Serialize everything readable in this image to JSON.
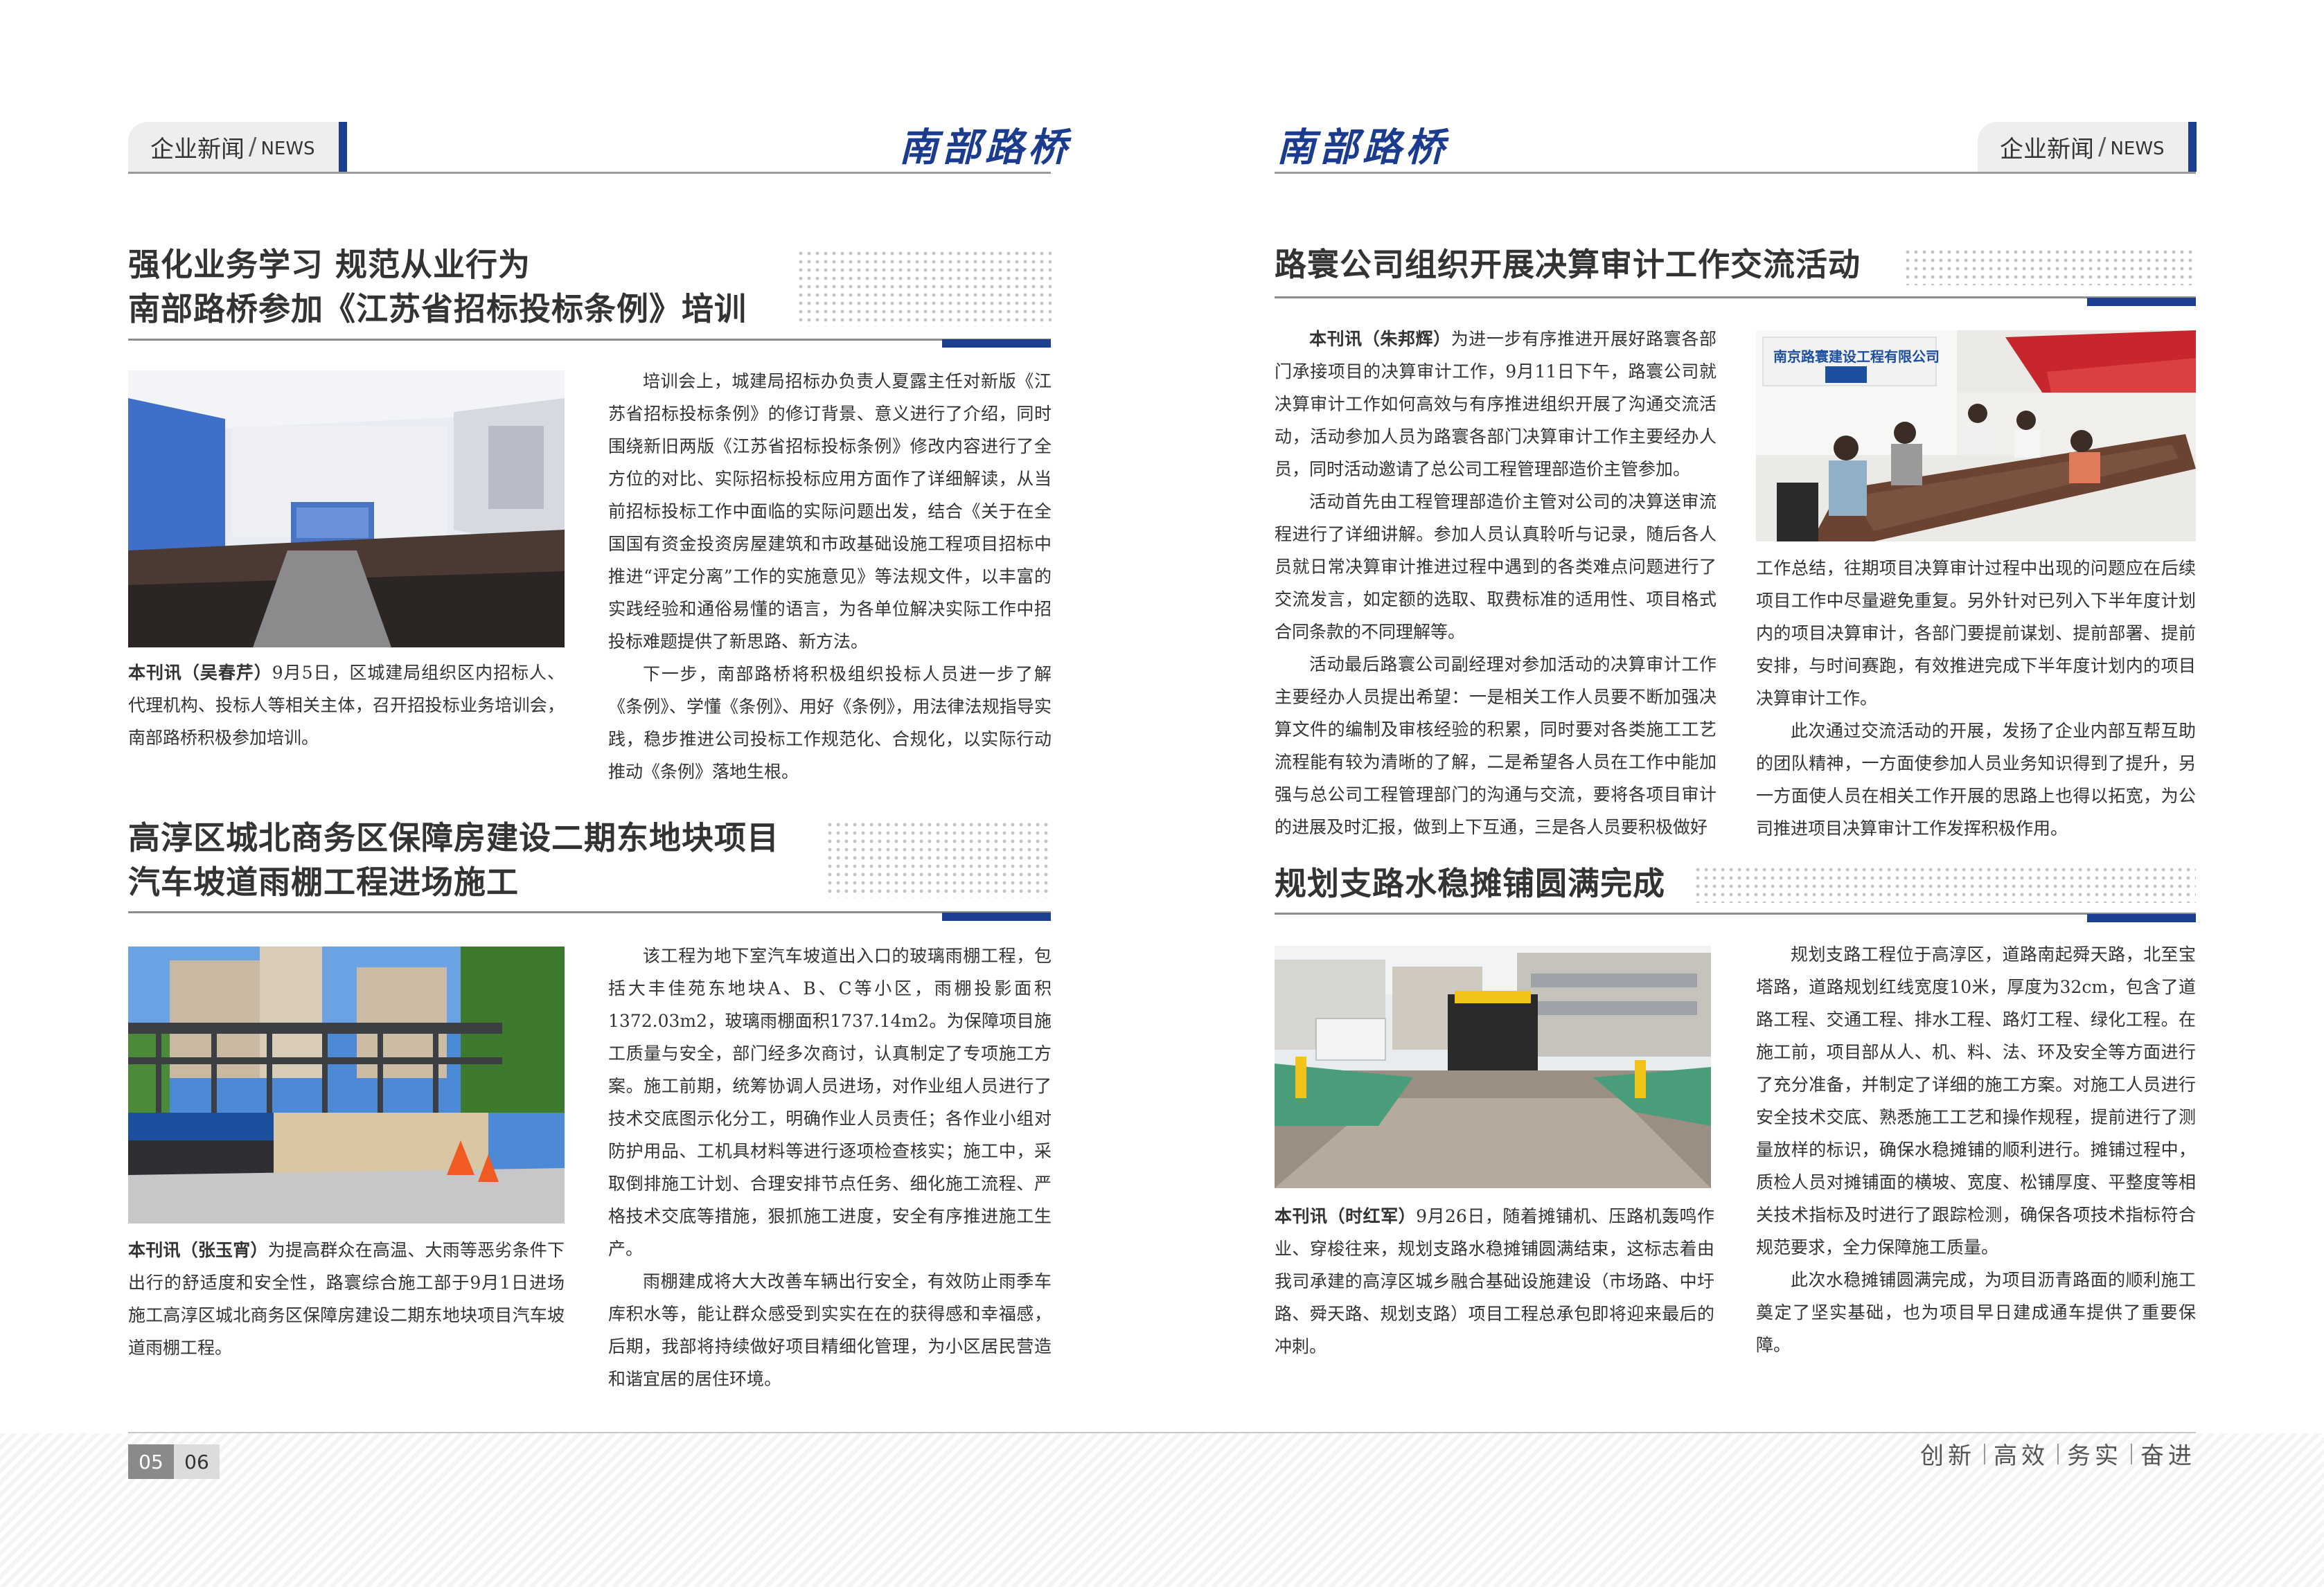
{
  "header": {
    "left_tab": {
      "cn": "企业新闻",
      "slash": "/",
      "en": "NEWS"
    },
    "right_tab": {
      "cn": "企业新闻",
      "slash": "/",
      "en": "NEWS"
    },
    "brand_left": "南部路桥",
    "brand_right": "南部路桥"
  },
  "colors": {
    "accent_blue": "#1c3f8f",
    "heading_grey": "#333333"
  },
  "articles": [
    {
      "title_line1": "强化业务学习  规范从业行为",
      "title_line2": "南部路桥参加《江苏省招标投标条例》培训",
      "image": "meeting-hall-photo",
      "caption_byline": "本刊讯（吴春芹）",
      "caption_text": "9月5日，区城建局组织区内招标人、代理机构、投标人等相关主体，召开招投标业务培训会，南部路桥积极参加培训。",
      "body": [
        "培训会上，城建局招标办负责人夏露主任对新版《江苏省招标投标条例》的修订背景、意义进行了介绍，同时围绕新旧两版《江苏省招标投标条例》修改内容进行了全方位的对比、实际招标投标应用方面作了详细解读，从当前招标投标工作中面临的实际问题出发，结合《关于在全国国有资金投资房屋建筑和市政基础设施工程项目招标中推进“评定分离”工作的实施意见》等法规文件，以丰富的实践经验和通俗易懂的语言，为各单位解决实际工作中招投标难题提供了新思路、新方法。",
        "下一步，南部路桥将积极组织投标人员进一步了解《条例》、学懂《条例》、用好《条例》，用法律法规指导实践，稳步推进公司投标工作规范化、合规化，以实际行动推动《条例》落地生根。"
      ]
    },
    {
      "title_line1": "高淳区城北商务区保障房建设二期东地块项目",
      "title_line2": "汽车坡道雨棚工程进场施工",
      "image": "canopy-construction-photo",
      "caption_byline": "本刊讯（张玉宵）",
      "caption_text": "为提高群众在高温、大雨等恶劣条件下出行的舒适度和安全性，路寰综合施工部于9月1日进场施工高淳区城北商务区保障房建设二期东地块项目汽车坡道雨棚工程。",
      "body": [
        "该工程为地下室汽车坡道出入口的玻璃雨棚工程，包括大丰佳苑东地块A、B、C等小区，雨棚投影面积1372.03m2，玻璃雨棚面积1737.14m2。为保障项目施工质量与安全，部门经多次商讨，认真制定了专项施工方案。施工前期，统筹协调人员进场，对作业组人员进行了技术交底图示化分工，明确作业人员责任；各作业小组对防护用品、工机具材料等进行逐项检查核实；施工中，采取倒排施工计划、合理安排节点任务、细化施工流程、严格技术交底等措施，狠抓施工进度，安全有序推进施工生产。",
        "雨棚建成将大大改善车辆出行安全，有效防止雨季车库积水等，能让群众感受到实实在在的获得感和幸福感，后期，我部将持续做好项目精细化管理，为小区居民营造和谐宜居的居住环境。"
      ]
    },
    {
      "title": "路寰公司组织开展决算审计工作交流活动",
      "image": "conference-room-photo",
      "image_sign": "南京路寰建设工程有限公司",
      "body_byline": "本刊讯（朱邦辉）",
      "body_first": "为进一步有序推进开展好路寰各部门承接项目的决算审计工作，9月11日下午，路寰公司就决算审计工作如何高效与有序推进组织开展了沟通交流活动，活动参加人员为路寰各部门决算审计工作主要经办人员，同时活动邀请了总公司工程管理部造价主管参加。",
      "body": [
        "活动首先由工程管理部造价主管对公司的决算送审流程进行了详细讲解。参加人员认真聆听与记录，随后各人员就日常决算审计推进过程中遇到的各类难点问题进行了交流发言，如定额的选取、取费标准的适用性、项目格式合同条款的不同理解等。",
        "活动最后路寰公司副经理对参加活动的决算审计工作主要经办人员提出希望：一是相关工作人员要不断加强决算文件的编制及审核经验的积累，同时要对各类施工工艺流程能有较为清晰的了解，二是希望各人员在工作中能加强与总公司工程管理部门的沟通与交流，要将各项目审计的进展及时汇报，做到上下互通，三是各人员要积极做好"
      ],
      "body_right_cont": "工作总结，往期项目决算审计过程中出现的问题应在后续项目工作中尽量避免重复。另外针对已列入下半年度计划内的项目决算审计，各部门要提前谋划、提前部署、提前安排，与时间赛跑，有效推进完成下半年度计划内的项目决算审计工作。",
      "body_right": "此次通过交流活动的开展，发扬了企业内部互帮互助的团队精神，一方面使参加人员业务知识得到了提升，另一方面使人员在相关工作开展的思路上也得以拓宽，为公司推进项目决算审计工作发挥积极作用。"
    },
    {
      "title": "规划支路水稳摊铺圆满完成",
      "image": "road-paving-photo",
      "caption_byline": "本刊讯（时红军）",
      "caption_text": "9月26日，随着摊铺机、压路机轰鸣作业、穿梭往来，规划支路水稳摊铺圆满结束，这标志着由我司承建的高淳区城乡融合基础设施建设（市场路、中圩路、舜天路、规划支路）项目工程总承包即将迎来最后的冲刺。",
      "body": [
        "规划支路工程位于高淳区，道路南起舜天路，北至宝塔路，道路规划红线宽度10米，厚度为32cm，包含了道路工程、交通工程、排水工程、路灯工程、绿化工程。在施工前，项目部从人、机、料、法、环及安全等方面进行了充分准备，并制定了详细的施工方案。对施工人员进行安全技术交底、熟悉施工工艺和操作规程，提前进行了测量放样的标识，确保水稳摊铺的顺利进行。摊铺过程中，质检人员对摊铺面的横坡、宽度、松铺厚度、平整度等相关技术指标及时进行了跟踪检测，确保各项技术指标符合规范要求，全力保障施工质量。",
        "此次水稳摊铺圆满完成，为项目沥青路面的顺利施工奠定了坚实基础，也为项目早日建成通车提供了重要保障。"
      ]
    }
  ],
  "footer": {
    "page_left": "05",
    "page_right": "06",
    "slogan": [
      "创新",
      "高效",
      "务实",
      "奋进"
    ]
  }
}
